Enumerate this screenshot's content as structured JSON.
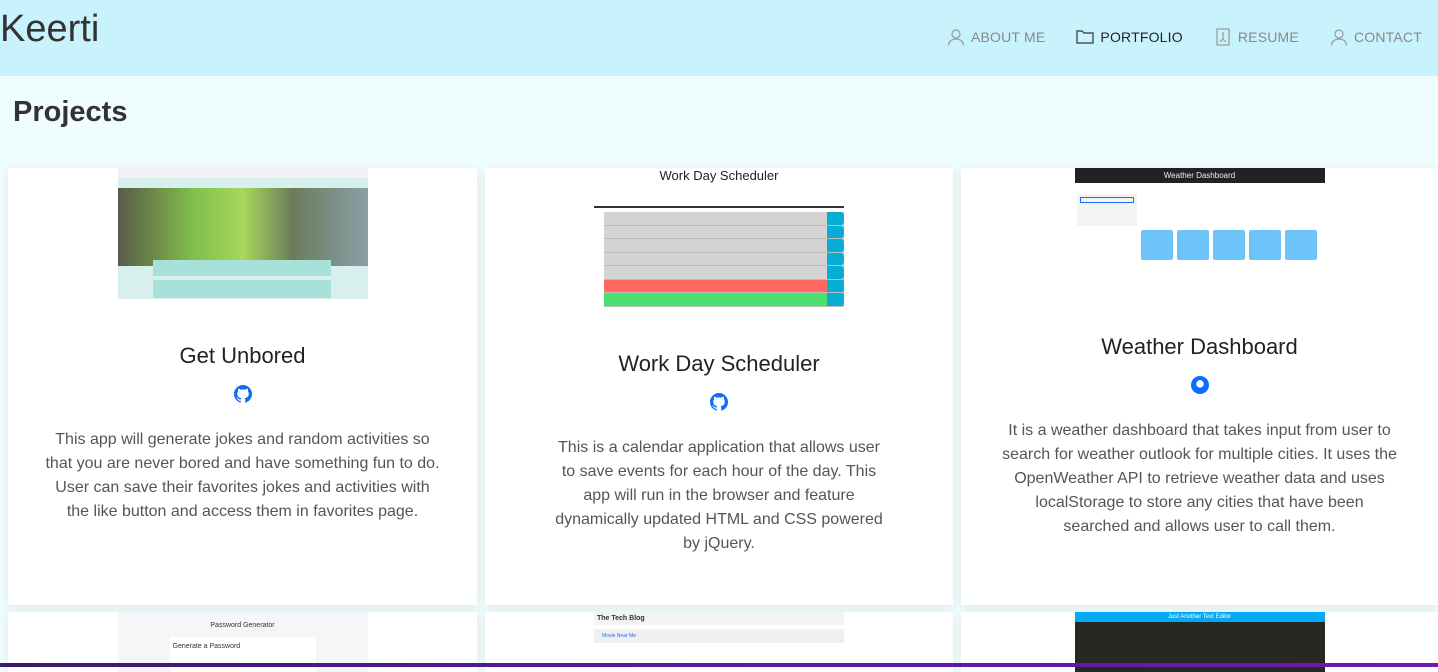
{
  "header": {
    "brand": "Keerti",
    "nav": [
      {
        "label": "ABOUT ME",
        "icon": "person-icon"
      },
      {
        "label": "PORTFOLIO",
        "icon": "folder-icon",
        "active": true
      },
      {
        "label": "RESUME",
        "icon": "pdf-file-icon"
      },
      {
        "label": "CONTACT",
        "icon": "person-icon"
      }
    ]
  },
  "page": {
    "title": "Projects"
  },
  "projects": [
    {
      "title": "Get Unbored",
      "description": "This app will generate jokes and random activities so that you are never bored and have something fun to do. User can save their favorites jokes and activities with the like button and access them in favorites page."
    },
    {
      "title": "Work Day Scheduler",
      "thumb_title": "Work Day Scheduler",
      "description": "This is a calendar application that allows user to save events for each hour of the day. This app will run in the browser and feature dynamically updated HTML and CSS powered by jQuery."
    },
    {
      "title": "Weather Dashboard",
      "thumb_title": "Weather Dashboard",
      "description": "It is a weather dashboard that takes input from user to search for weather outlook for multiple cities. It uses the OpenWeather API to retrieve weather data and uses localStorage to store any cities that have been searched and allows user to call them."
    },
    {
      "thumb_title": "Password Generator",
      "thumb_sub": "Generate a Password"
    },
    {
      "thumb_title": "The Tech Blog",
      "thumb_sub": "Movie Near Me"
    },
    {
      "thumb_title": "Just Another Text Editor"
    }
  ],
  "colors": {
    "header_bg": "#c9f3fc",
    "page_bg": "#effdfe",
    "link_blue": "#0d6efd"
  }
}
